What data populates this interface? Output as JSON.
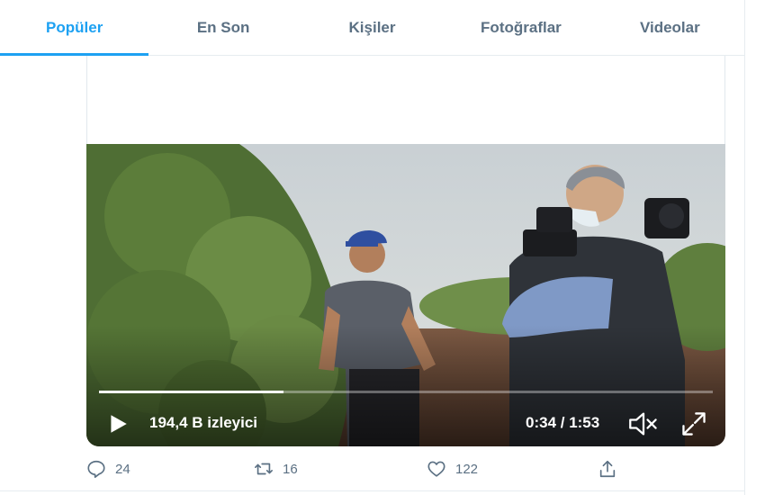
{
  "tabs": [
    {
      "label": "Popüler",
      "active": true
    },
    {
      "label": "En Son",
      "active": false
    },
    {
      "label": "Kişiler",
      "active": false
    },
    {
      "label": "Fotoğraflar",
      "active": false
    },
    {
      "label": "Videolar",
      "active": false
    }
  ],
  "video": {
    "views": "194,4 B izleyici",
    "time": "0:34 / 1:53",
    "progress": 0.3
  },
  "actions": {
    "reply_count": "24",
    "retweet_count": "16",
    "like_count": "122"
  },
  "colors": {
    "accent": "#1da1f2",
    "muted": "#5b7083",
    "border": "#e6ecf0"
  },
  "icons": [
    "play-icon",
    "volume-icon",
    "fullscreen-icon",
    "reply-icon",
    "retweet-icon",
    "like-icon",
    "share-icon"
  ]
}
